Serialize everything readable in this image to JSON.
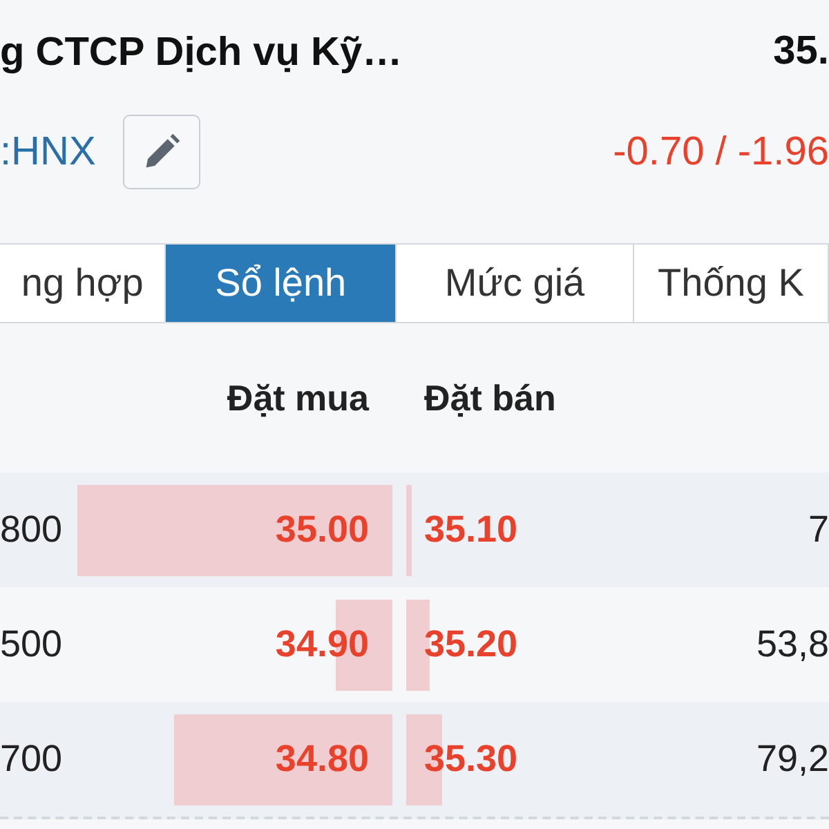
{
  "header": {
    "company_name": "g CTCP Dịch vụ Kỹ…",
    "price": "35.",
    "exchange": ":HNX",
    "change": "-0.70 / -1.96"
  },
  "tabs": [
    {
      "label": "ng hợp",
      "selected": false
    },
    {
      "label": "Sổ lệnh",
      "selected": true
    },
    {
      "label": "Mức giá",
      "selected": false
    },
    {
      "label": "Thống K",
      "selected": false
    }
  ],
  "order_book": {
    "columns": [
      "Đặt mua",
      "Đặt bán"
    ],
    "rows": [
      {
        "bid_volume": "800",
        "bid": {
          "price": "35.00"
        },
        "ask": {
          "price": "35.10"
        },
        "ask_volume": "7"
      },
      {
        "bid_volume": "500",
        "bid": {
          "price": "34.90"
        },
        "ask": {
          "price": "35.20"
        },
        "ask_volume": "53,8"
      },
      {
        "bid_volume": "700",
        "bid": {
          "price": "34.80"
        },
        "ask": {
          "price": "35.30"
        },
        "ask_volume": "79,2"
      }
    ]
  }
}
